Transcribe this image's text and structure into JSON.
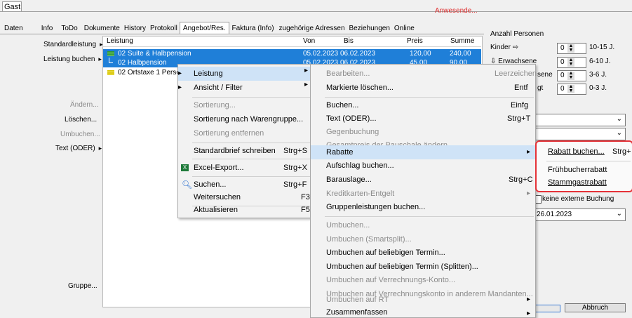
{
  "header": {
    "gast_tab": "Gast",
    "anwesende": "Anwesende..."
  },
  "tabs": [
    "Daten",
    "Info",
    "ToDo",
    "Dokumente",
    "History",
    "Protokoll",
    "Angebot/Res.",
    "Faktura (Info)",
    "zugehörige Adressen",
    "Beziehungen",
    "Online"
  ],
  "left_menu": {
    "standardleistung": "Standardleistung",
    "leistung_buchen": "Leistung buchen",
    "aendern": "Ändern...",
    "loeschen": "Löschen...",
    "umbuchen": "Umbuchen...",
    "text_oder": "Text (ODER)",
    "gruppe": "Gruppe..."
  },
  "grid": {
    "columns": [
      "Leistung",
      "Von",
      "Bis",
      "Preis",
      "Summe"
    ],
    "rows": [
      {
        "leistung": "02 Suite & Halbpension",
        "von": "05.02.2023",
        "bis": "06.02.2023",
        "preis": "120,00",
        "summe": "240,00"
      },
      {
        "leistung": "02 Halbpension",
        "von": "05.02.2023",
        "bis": "06.02.2023",
        "preis": "45,00",
        "summe": "90,00"
      },
      {
        "leistung": "02 Ortstaxe 1 Person",
        "von": "",
        "bis": "",
        "preis": "",
        "summe": ""
      }
    ]
  },
  "right_panel": {
    "anzahl_personen": "Anzahl Personen",
    "kinder": "Kinder",
    "erwachsene": "Erwachsene",
    "senioren_suffix": "sene",
    "gt_suffix": "gt",
    "spin_values": [
      "0",
      "0",
      "0",
      "0"
    ],
    "age_ranges": [
      "10-15 J.",
      "6-10 J.",
      "3-6 J.",
      "0-3 J."
    ],
    "keine_externe_buchung": "keine externe Buchung",
    "date": "26.01.2023",
    "abbruch_button": "Abbruch"
  },
  "context_menu": {
    "items": [
      {
        "label": "Leistung",
        "shortcut": "",
        "submenu": true
      },
      {
        "label": "Ansicht / Filter",
        "shortcut": "",
        "submenu": true
      },
      {
        "label": "Sortierung...",
        "shortcut": ""
      },
      {
        "label": "Sortierung nach Warengruppe...",
        "shortcut": ""
      },
      {
        "label": "Sortierung entfernen",
        "shortcut": ""
      },
      {
        "label": "Standardbrief schreiben",
        "shortcut": "Strg+S"
      },
      {
        "label": "Excel-Export...",
        "shortcut": "Strg+X"
      },
      {
        "label": "Suchen...",
        "shortcut": "Strg+F"
      },
      {
        "label": "Weitersuchen",
        "shortcut": "F3"
      },
      {
        "label": "Aktualisieren",
        "shortcut": "F5"
      }
    ]
  },
  "leistung_submenu": {
    "items": [
      {
        "label": "Bearbeiten...",
        "shortcut": "Leerzeichen"
      },
      {
        "label": "Markierte löschen...",
        "shortcut": "Entf"
      },
      {
        "label": "Buchen...",
        "shortcut": "Einfg"
      },
      {
        "label": "Text (ODER)...",
        "shortcut": "Strg+T"
      },
      {
        "label": "Gegenbuchung",
        "shortcut": ""
      },
      {
        "label": "Gesamtpreis der Pauschale ändern...",
        "shortcut": ""
      },
      {
        "label": "Rabatte",
        "shortcut": ""
      },
      {
        "label": "Aufschlag buchen...",
        "shortcut": ""
      },
      {
        "label": "Barauslage...",
        "shortcut": "Strg+C"
      },
      {
        "label": "Kreditkarten-Entgelt",
        "shortcut": ""
      },
      {
        "label": "Gruppenleistungen buchen...",
        "shortcut": ""
      },
      {
        "label": "Umbuchen...",
        "shortcut": ""
      },
      {
        "label": "Umbuchen (Smartsplit)...",
        "shortcut": ""
      },
      {
        "label": "Umbuchen auf beliebigen Termin...",
        "shortcut": ""
      },
      {
        "label": "Umbuchen auf beliebigen Termin (Splitten)...",
        "shortcut": ""
      },
      {
        "label": "Umbuchen auf Verrechnungs-Konto...",
        "shortcut": ""
      },
      {
        "label": "Umbuchen auf Verrechnungskonto in anderem Mandanten...",
        "shortcut": ""
      },
      {
        "label": "Umbuchen auf RT",
        "shortcut": ""
      },
      {
        "label": "Zusammenfassen",
        "shortcut": ""
      }
    ]
  },
  "rabatte_submenu": {
    "items": [
      {
        "label": "Rabatt buchen...",
        "shortcut": "Strg+"
      },
      {
        "label": "Frühbucherrabatt",
        "shortcut": ""
      },
      {
        "label": "Stammgastrabatt",
        "shortcut": ""
      }
    ]
  },
  "colors": {
    "selection": "#1f7fd8",
    "highlight": "#cfe3f7",
    "red_box": "#e53238",
    "anwesende": "#e03030"
  }
}
